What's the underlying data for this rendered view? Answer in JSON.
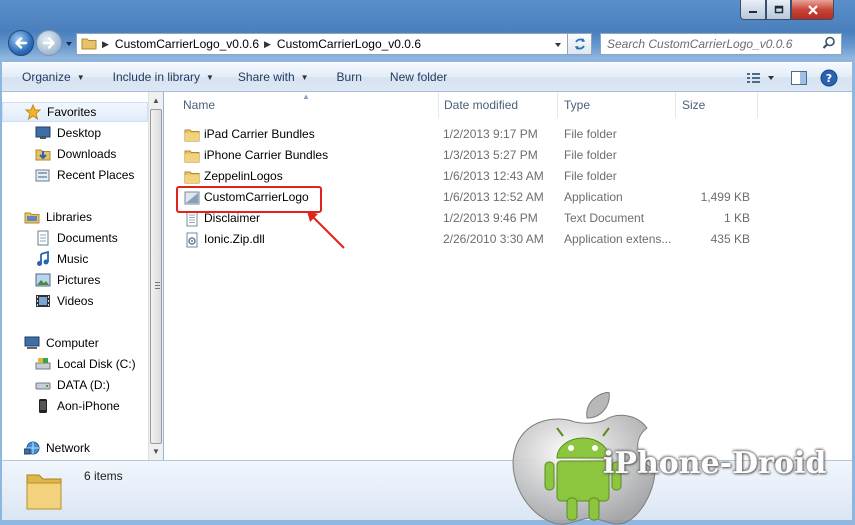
{
  "window": {
    "controls": {
      "minimize": "minimize-icon",
      "maximize": "maximize-icon",
      "close": "close-icon"
    }
  },
  "address_bar": {
    "breadcrumbs": [
      "CustomCarrierLogo_v0.0.6",
      "CustomCarrierLogo_v0.0.6"
    ]
  },
  "search": {
    "placeholder": "Search CustomCarrierLogo_v0.0.6"
  },
  "toolbar": {
    "organize": "Organize",
    "include_in_library": "Include in library",
    "share_with": "Share with",
    "burn": "Burn",
    "new_folder": "New folder"
  },
  "nav_pane": {
    "favorites": {
      "label": "Favorites",
      "items": [
        "Desktop",
        "Downloads",
        "Recent Places"
      ]
    },
    "libraries": {
      "label": "Libraries",
      "items": [
        "Documents",
        "Music",
        "Pictures",
        "Videos"
      ]
    },
    "computer": {
      "label": "Computer",
      "items": [
        "Local Disk (C:)",
        "DATA (D:)",
        "Aon-iPhone"
      ]
    },
    "network": {
      "label": "Network"
    }
  },
  "file_list": {
    "columns": {
      "name": "Name",
      "date": "Date modified",
      "type": "Type",
      "size": "Size"
    },
    "rows": [
      {
        "name": "iPad Carrier Bundles",
        "date": "1/2/2013 9:17 PM",
        "type": "File folder",
        "size": "",
        "icon": "folder-icon"
      },
      {
        "name": "iPhone Carrier Bundles",
        "date": "1/3/2013 5:27 PM",
        "type": "File folder",
        "size": "",
        "icon": "folder-icon"
      },
      {
        "name": "ZeppelinLogos",
        "date": "1/6/2013 12:43 AM",
        "type": "File folder",
        "size": "",
        "icon": "folder-icon"
      },
      {
        "name": "CustomCarrierLogo",
        "date": "1/6/2013 12:52 AM",
        "type": "Application",
        "size": "1,499 KB",
        "icon": "application-icon"
      },
      {
        "name": "Disclaimer",
        "date": "1/2/2013 9:46 PM",
        "type": "Text Document",
        "size": "1 KB",
        "icon": "text-document-icon"
      },
      {
        "name": "Ionic.Zip.dll",
        "date": "2/26/2010 3:30 AM",
        "type": "Application extens...",
        "size": "435 KB",
        "icon": "dll-icon"
      }
    ]
  },
  "details": {
    "item_count": "6 items"
  },
  "watermark": {
    "text": "iPhone-Droid"
  },
  "colors": {
    "highlight": "#e0241b",
    "accent": "#3a6fa8"
  }
}
